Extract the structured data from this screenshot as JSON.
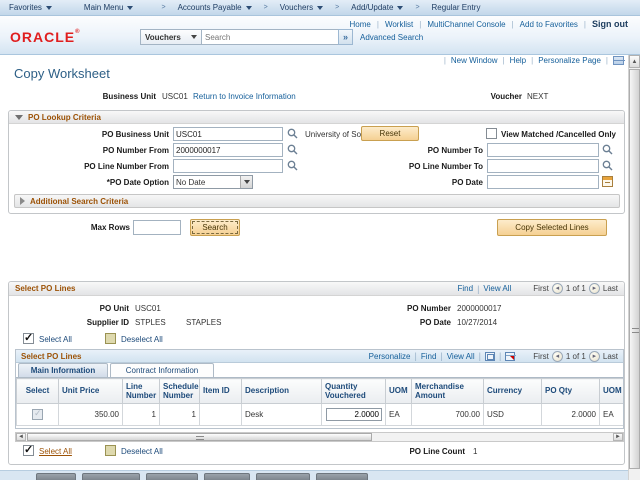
{
  "colors": {
    "accent_orange": "#9c5206",
    "link_blue": "#155f9a",
    "header_navy": "#1d4a7a",
    "button_face": "#f5d093",
    "logo_red": "#e01e1e"
  },
  "breadcrumb": {
    "items": [
      "Favorites",
      "Main Menu",
      "Accounts Payable",
      "Vouchers",
      "Add/Update",
      "Regular Entry"
    ]
  },
  "header": {
    "logo": "ORACLE",
    "search_scope": "Vouchers",
    "search_placeholder": "Search",
    "advanced_search": "Advanced Search",
    "links": [
      "Home",
      "Worklist",
      "MultiChannel Console",
      "Add to Favorites"
    ],
    "sign_out": "Sign out"
  },
  "utility": {
    "new_window": "New Window",
    "help": "Help",
    "personalize_page": "Personalize Page"
  },
  "page": {
    "title": "Copy Worksheet"
  },
  "invoice_bar": {
    "business_unit_label": "Business Unit",
    "business_unit_value": "USC01",
    "return_link": "Return to Invoice Information",
    "voucher_label": "Voucher",
    "voucher_value": "NEXT"
  },
  "po_lookup": {
    "title": "PO Lookup Criteria",
    "po_business_unit_label": "PO Business Unit",
    "po_business_unit_value": "USC01",
    "po_business_unit_desc": "University of South Carolina",
    "reset_button": "Reset",
    "view_matched_label": "View Matched /Cancelled Only",
    "po_number_from_label": "PO Number From",
    "po_number_from_value": "2000000017",
    "po_number_to_label": "PO Number To",
    "po_number_to_value": "",
    "po_line_number_from_label": "PO Line Number From",
    "po_line_number_from_value": "",
    "po_line_number_to_label": "PO Line Number To",
    "po_line_number_to_value": "",
    "po_date_option_label": "*PO Date Option",
    "po_date_option_value": "No Date",
    "po_date_label": "PO Date",
    "po_date_value": ""
  },
  "additional_search": {
    "title": "Additional Search Criteria"
  },
  "actions": {
    "max_rows_label": "Max Rows",
    "max_rows_value": "",
    "search_button": "Search",
    "copy_selected_button": "Copy Selected Lines"
  },
  "select_po_lines": {
    "title": "Select PO Lines",
    "find": "Find",
    "view_all": "View All",
    "pager": {
      "first": "First",
      "count": "1 of 1",
      "last": "Last"
    },
    "po_unit_label": "PO Unit",
    "po_unit_value": "USC01",
    "po_number_label": "PO Number",
    "po_number_value": "2000000017",
    "supplier_id_label": "Supplier ID",
    "supplier_id_value": "STPLES",
    "supplier_name": "STAPLES",
    "po_date_label": "PO Date",
    "po_date_value": "10/27/2014",
    "select_all_label": "Select All",
    "deselect_all_label": "Deselect All",
    "po_line_count_label": "PO Line Count",
    "po_line_count_value": "1"
  },
  "grid": {
    "title": "Select PO Lines",
    "personalize": "Personalize",
    "find": "Find",
    "view_all": "View All",
    "pager": {
      "first": "First",
      "count": "1 of 1",
      "last": "Last"
    },
    "tabs": [
      "Main Information",
      "Contract Information"
    ],
    "columns": [
      "Select",
      "Unit Price",
      "Line Number",
      "Schedule Number",
      "Item ID",
      "Description",
      "Quantity Vouchered",
      "UOM",
      "Merchandise Amount",
      "Currency",
      "PO Qty",
      "UOM"
    ],
    "row": {
      "unit_price": "350.00",
      "line_number": "1",
      "schedule_number": "1",
      "item_id": "",
      "description": "Desk",
      "quantity_vouchered": "2.0000",
      "uom": "EA",
      "merchandise_amount": "700.00",
      "currency": "USD",
      "po_qty": "2.0000",
      "uom_2": "EA"
    }
  }
}
